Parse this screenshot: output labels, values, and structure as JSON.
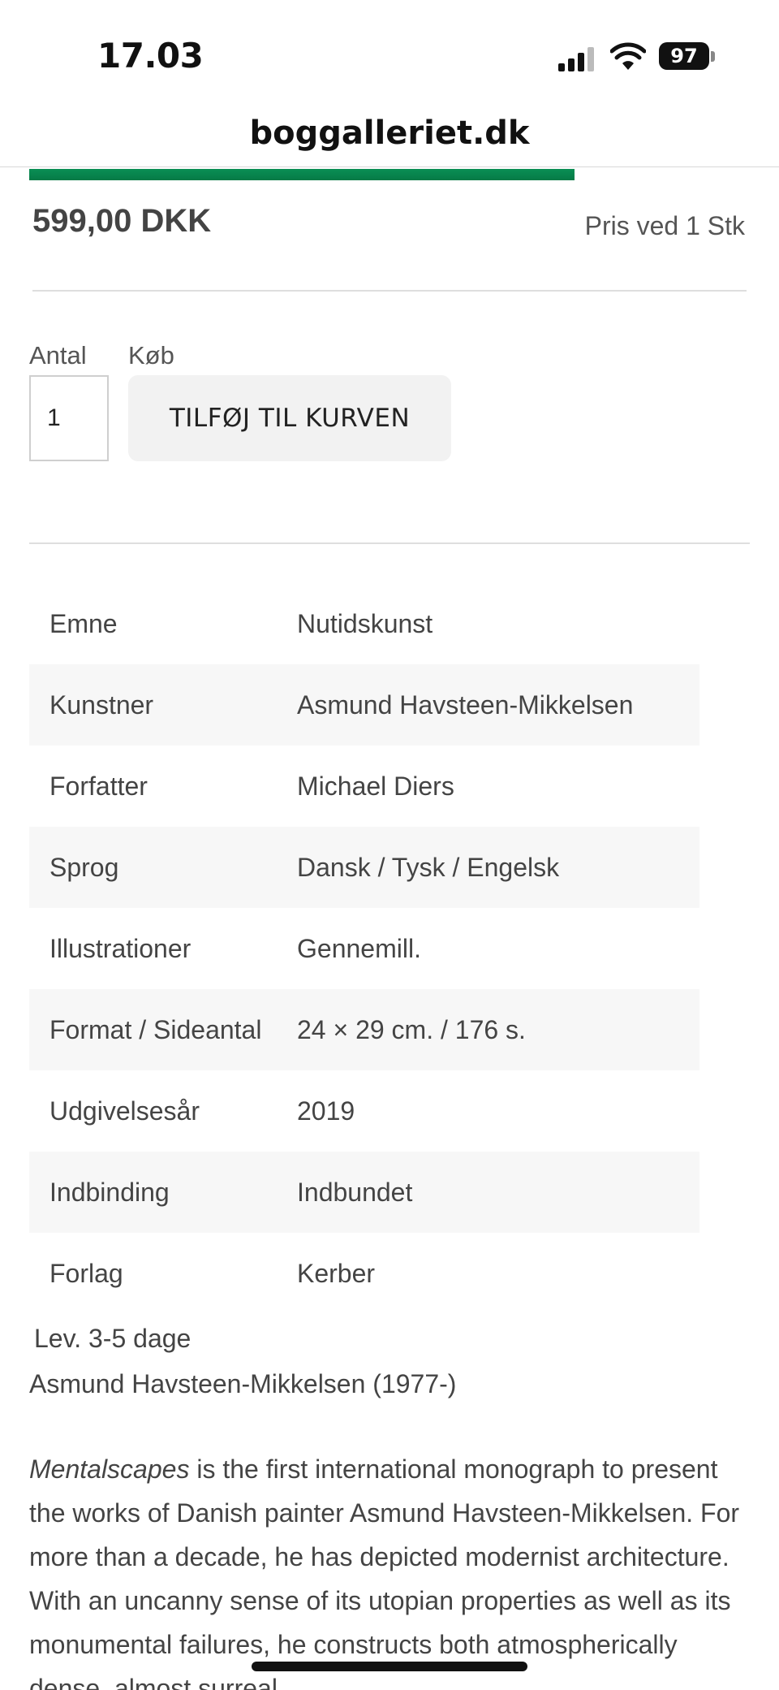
{
  "status_bar": {
    "time": "17.03",
    "battery": "97",
    "icons": [
      "signal-icon",
      "wifi-icon",
      "battery-icon"
    ]
  },
  "browser": {
    "url": "boggalleriet.dk"
  },
  "product": {
    "price": "599,00 DKK",
    "price_unit": "Pris ved 1 Stk",
    "quantity_label": "Antal",
    "quantity_value": "1",
    "buy_label": "Køb",
    "add_to_cart": "TILFØJ TIL KURVEN"
  },
  "specs": [
    {
      "key": "Emne",
      "value": "Nutidskunst"
    },
    {
      "key": "Kunstner",
      "value": "Asmund Havsteen-Mikkelsen"
    },
    {
      "key": "Forfatter",
      "value": "Michael Diers"
    },
    {
      "key": "Sprog",
      "value": "Dansk / Tysk / Engelsk"
    },
    {
      "key": "Illustrationer",
      "value": "Gennemill."
    },
    {
      "key": "Format / Sideantal",
      "value": "24 × 29 cm. / 176 s."
    },
    {
      "key": "Udgivelsesår",
      "value": "2019"
    },
    {
      "key": "Indbinding",
      "value": "Indbundet"
    },
    {
      "key": "Forlag",
      "value": "Kerber"
    }
  ],
  "delivery": "Lev. 3-5 dage",
  "artist_line": "Asmund Havsteen-Mikkelsen (1977-)",
  "description": {
    "title_italic": "Mentalscapes",
    "text": " is the first international monograph to present the works of Danish painter Asmund Havsteen-Mikkelsen. For more than a decade, he has depicted modernist architecture. With an uncanny sense of its utopian properties as well as its monumental failures, he constructs both atmospherically dense, almost surreal"
  },
  "colors": {
    "accent_green": "#0a8f55",
    "row_alt": "#f7f7f7",
    "button_bg": "#f2f2f2"
  }
}
